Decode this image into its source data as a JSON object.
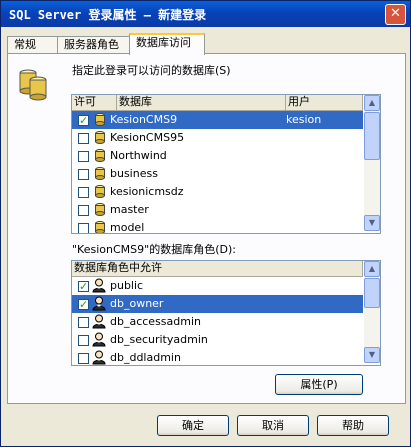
{
  "window": {
    "title": "SQL Server 登录属性 — 新建登录",
    "close_symbol": "✕"
  },
  "tabs": [
    {
      "label": "常规"
    },
    {
      "label": "服务器角色"
    },
    {
      "label": "数据库访问"
    }
  ],
  "panel": {
    "instruction": "指定此登录可以访问的数据库(S)",
    "db_columns": [
      "许可",
      "数据库",
      "用户"
    ],
    "databases": [
      {
        "checked": true,
        "name": "KesionCMS9",
        "user": "kesion",
        "selected": true
      },
      {
        "checked": false,
        "name": "KesionCMS95",
        "user": ""
      },
      {
        "checked": false,
        "name": "Northwind",
        "user": ""
      },
      {
        "checked": false,
        "name": "business",
        "user": ""
      },
      {
        "checked": false,
        "name": "kesionicmsdz",
        "user": ""
      },
      {
        "checked": false,
        "name": "master",
        "user": ""
      },
      {
        "checked": false,
        "name": "model",
        "user": ""
      }
    ],
    "roles_label": "\"KesionCMS9\"的数据库角色(D):",
    "role_column": "数据库角色中允许",
    "roles": [
      {
        "checked": true,
        "name": "public"
      },
      {
        "checked": true,
        "name": "db_owner",
        "selected": true
      },
      {
        "checked": false,
        "name": "db_accessadmin"
      },
      {
        "checked": false,
        "name": "db_securityadmin"
      },
      {
        "checked": false,
        "name": "db_ddladmin"
      }
    ],
    "properties_button": "属性(P)"
  },
  "footer": {
    "ok": "确定",
    "cancel": "取消",
    "help": "帮助"
  },
  "colors": {
    "title_bar": "#0843b8",
    "selection": "#316ac5",
    "dialog_bg": "#ece9d8"
  },
  "icons": [
    "database-stack-icon",
    "database-icon",
    "role-person-icon",
    "close-icon",
    "scroll-up-icon",
    "scroll-down-icon"
  ]
}
